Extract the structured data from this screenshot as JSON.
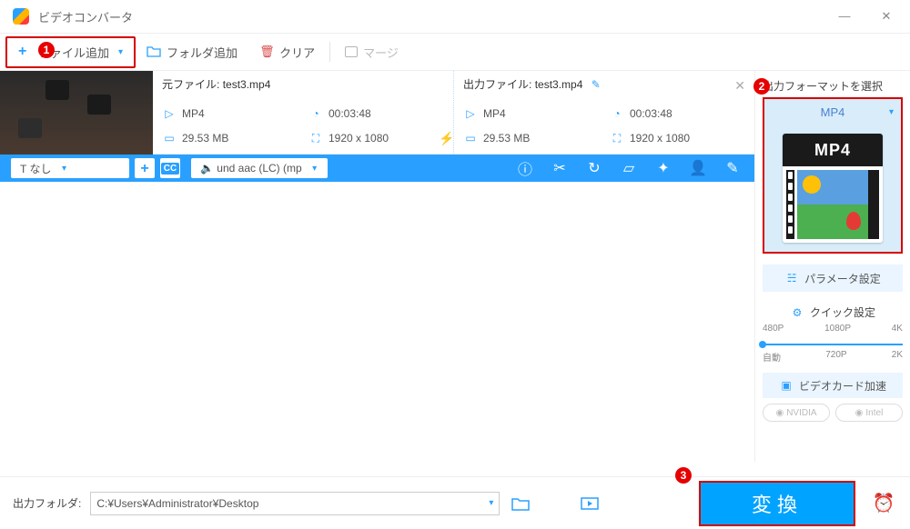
{
  "titlebar": {
    "title": "ビデオコンバータ"
  },
  "toolbar": {
    "add_file": "ファイル追加",
    "add_folder": "フォルダ追加",
    "clear": "クリア",
    "merge": "マージ"
  },
  "file": {
    "src_label": "元ファイル:",
    "src_name": "test3.mp4",
    "out_label": "出力ファイル:",
    "out_name": "test3.mp4",
    "src": {
      "format": "MP4",
      "duration": "00:03:48",
      "size": "29.53 MB",
      "resolution": "1920 x 1080"
    },
    "out": {
      "format": "MP4",
      "duration": "00:03:48",
      "size": "29.53 MB",
      "resolution": "1920 x 1080"
    }
  },
  "strip": {
    "subtitle_mode": "T なし",
    "audio_track": "und aac (LC) (mp",
    "cc_label": "CC",
    "sound_icon": "🔈"
  },
  "right": {
    "format_header": "出力フォーマットを選択",
    "selected_format": "MP4",
    "film_label": "MP4",
    "param_btn": "パラメータ設定",
    "quick_label": "クイック設定",
    "res_top": [
      "480P",
      "1080P",
      "4K"
    ],
    "res_bot": [
      "自動",
      "720P",
      "2K"
    ],
    "hw_accel": "ビデオカード加速",
    "chip_nvidia": "NVIDIA",
    "chip_intel": "Intel"
  },
  "footer": {
    "out_folder_label": "出力フォルダ:",
    "out_path": "C:¥Users¥Administrator¥Desktop",
    "convert_label": "変換"
  },
  "callouts": [
    "1",
    "2",
    "3"
  ]
}
